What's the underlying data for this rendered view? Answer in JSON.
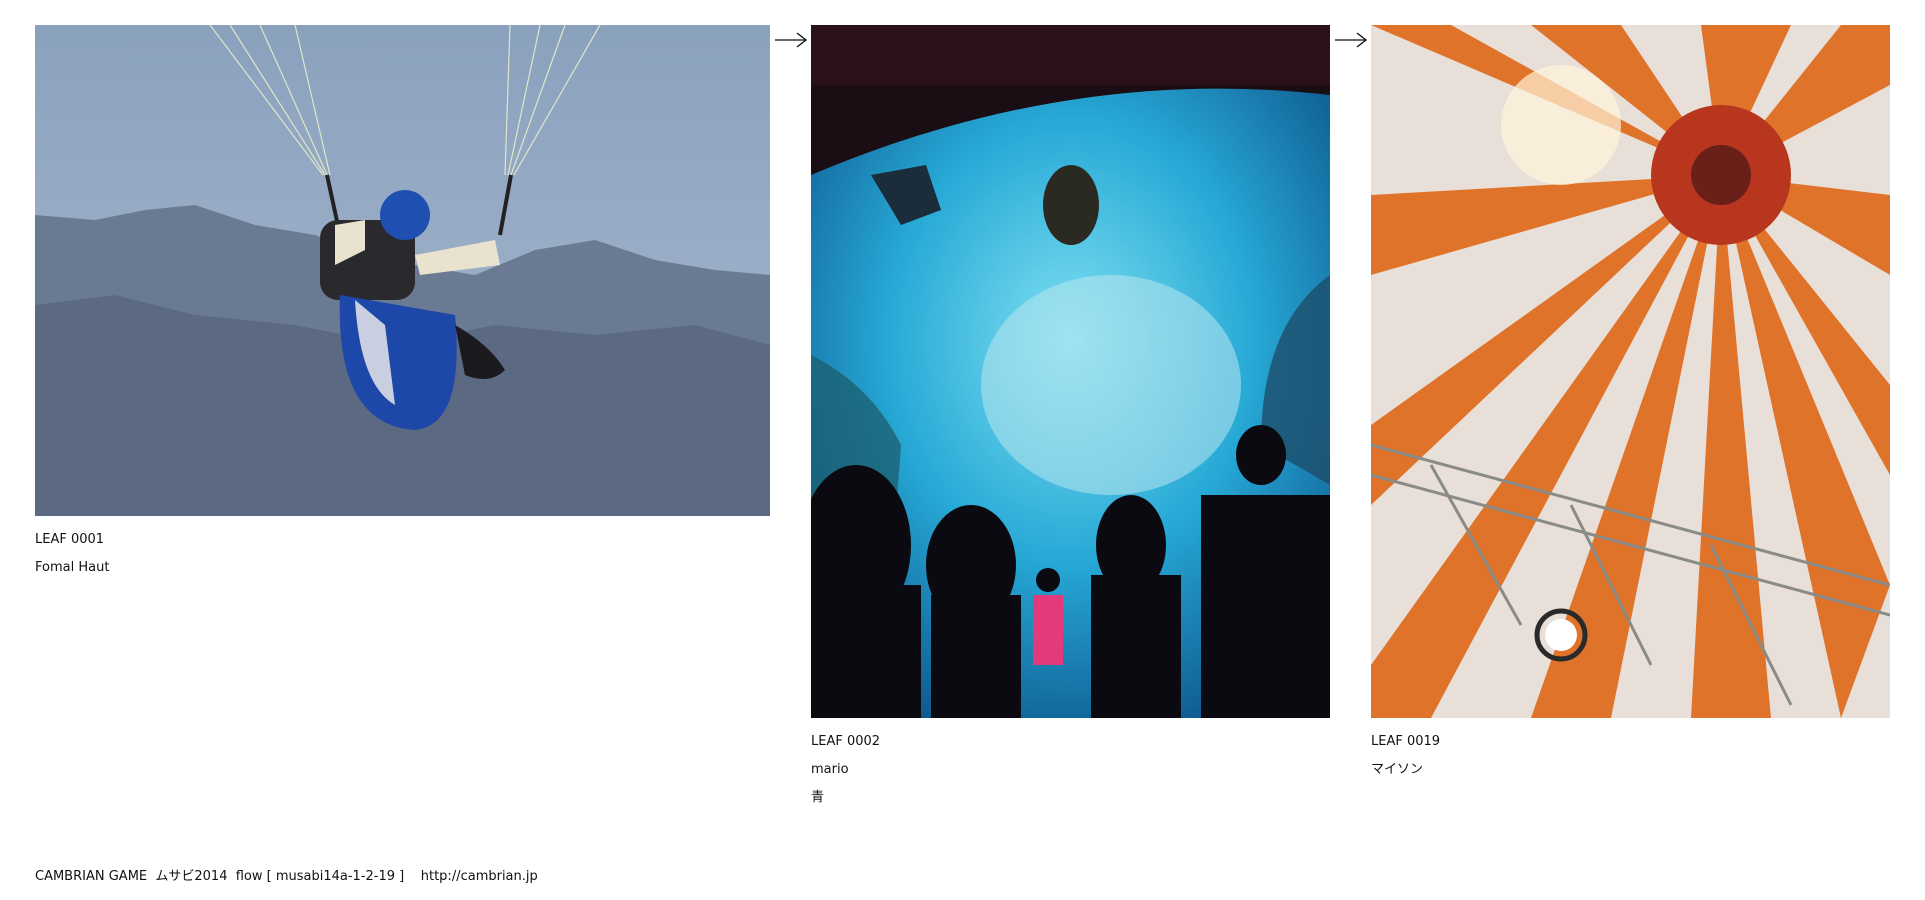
{
  "leaves": [
    {
      "id_label": "LEAF 0001",
      "author": "Fomal Haut",
      "note": "",
      "image_subject": "paraglider-photo"
    },
    {
      "id_label": "LEAF 0002",
      "author": "mario",
      "note": "青",
      "image_subject": "aquarium-photo"
    },
    {
      "id_label": "LEAF 0019",
      "author": "マイソン",
      "note": "",
      "image_subject": "striped-tent-ceiling-photo"
    }
  ],
  "footer": {
    "credit": "CAMBRIAN GAME  ムサビ2014  flow [ musabi14a-1-2-19 ]",
    "url": "http://cambrian.jp"
  },
  "colors": {
    "text": "#111111",
    "background": "#ffffff",
    "sky": "#9fb0c8",
    "water": "#2aa8d8",
    "tent_orange": "#e0732a"
  }
}
